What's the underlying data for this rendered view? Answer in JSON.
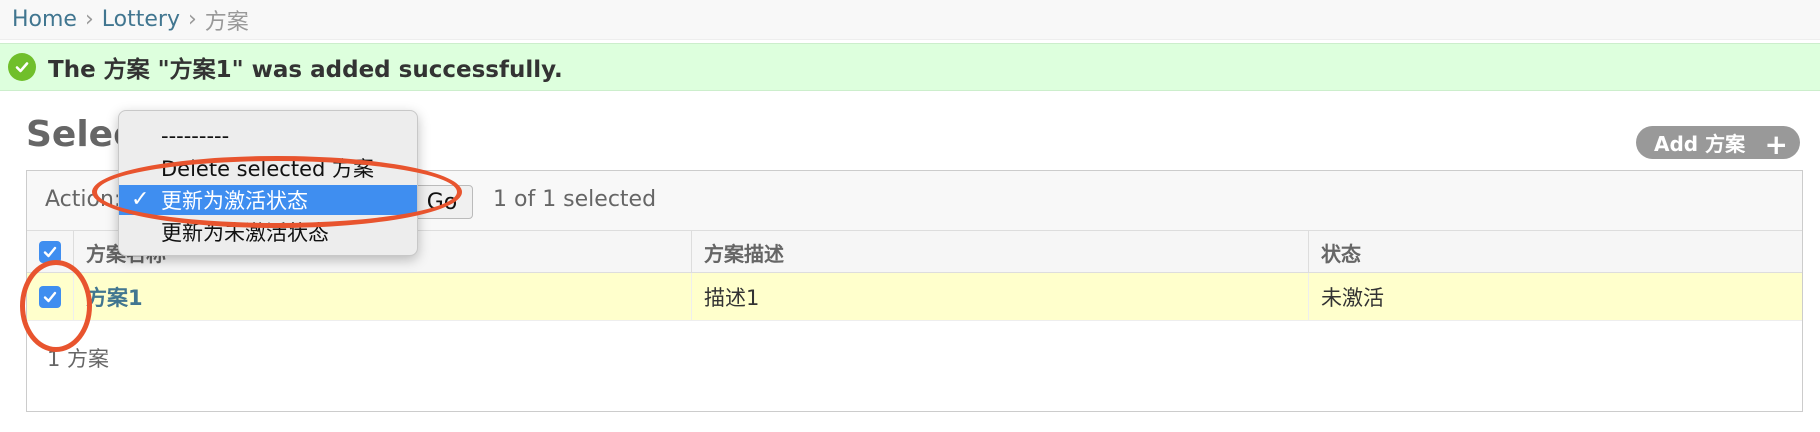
{
  "breadcrumbs": {
    "home": "Home",
    "app": "Lottery",
    "current": "方案",
    "separator": "›"
  },
  "message": {
    "text": "The 方案 \"方案1\" was added successfully."
  },
  "page": {
    "title": "Selec"
  },
  "add_button": {
    "label": "Add 方案",
    "icon": "plus-icon"
  },
  "actions": {
    "label": "Action:",
    "go_label": "Go",
    "counter": "1 of 1 selected",
    "options": [
      {
        "label": "---------",
        "selected": false
      },
      {
        "label": "Delete selected 方案",
        "selected": false
      },
      {
        "label": "更新为激活状态",
        "selected": true
      },
      {
        "label": "更新为未激活状态",
        "selected": false
      }
    ]
  },
  "table": {
    "columns": [
      "方案名称",
      "方案描述",
      "状态"
    ],
    "rows": [
      {
        "name": "方案1",
        "description": "描述1",
        "status": "未激活",
        "checked": true
      }
    ]
  },
  "paginator": {
    "text": "1 方案"
  },
  "colors": {
    "selected_row": "#ffffcc",
    "success_bg": "#ddffdd",
    "accent": "#3f8ef0",
    "annotation": "#e8542e"
  }
}
